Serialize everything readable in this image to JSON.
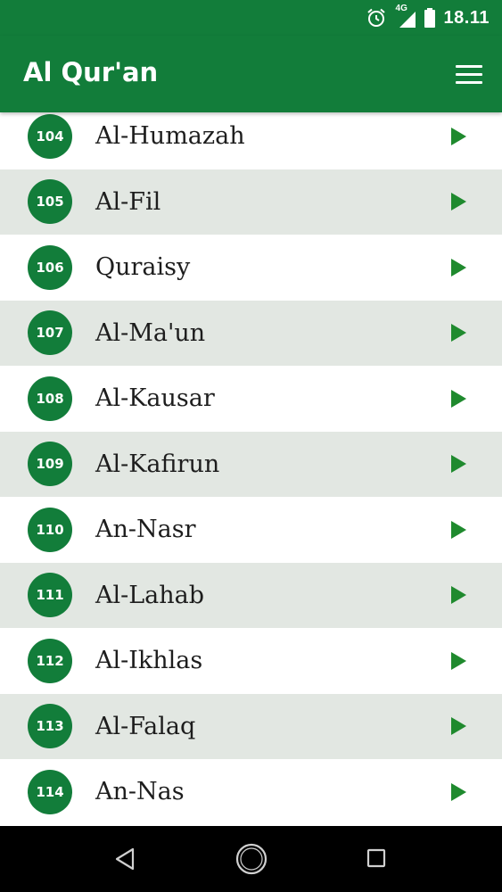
{
  "status_bar": {
    "network_label": "4G",
    "time": "18.11",
    "icons": [
      "alarm-icon",
      "signal-icon",
      "battery-icon"
    ]
  },
  "app_bar": {
    "title": "Al Qur'an",
    "menu_icon": "hamburger-menu-icon"
  },
  "surah_list": [
    {
      "number": "104",
      "name": "Al-Humazah"
    },
    {
      "number": "105",
      "name": "Al-Fil"
    },
    {
      "number": "106",
      "name": "Quraisy"
    },
    {
      "number": "107",
      "name": "Al-Ma'un"
    },
    {
      "number": "108",
      "name": "Al-Kausar"
    },
    {
      "number": "109",
      "name": "Al-Kafirun"
    },
    {
      "number": "110",
      "name": "An-Nasr"
    },
    {
      "number": "111",
      "name": "Al-Lahab"
    },
    {
      "number": "112",
      "name": "Al-Ikhlas"
    },
    {
      "number": "113",
      "name": "Al-Falaq"
    },
    {
      "number": "114",
      "name": "An-Nas"
    }
  ],
  "nav_bar": {
    "icons": [
      "back-icon",
      "home-icon",
      "recents-icon"
    ]
  },
  "colors": {
    "primary": "#127d3a",
    "alt_row": "#e2e7e2",
    "play": "#1f8a2e"
  }
}
